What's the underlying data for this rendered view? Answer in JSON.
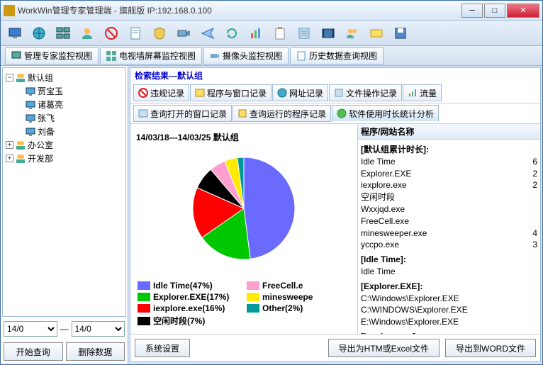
{
  "window": {
    "title": "WorkWin管理专家管理端 - 旗舰版 IP:192.168.0.100"
  },
  "maintabs": [
    {
      "label": "管理专家监控视图"
    },
    {
      "label": "电视墙屏幕监控视图"
    },
    {
      "label": "摄像头监控视图"
    },
    {
      "label": "历史数据查询视图"
    }
  ],
  "tree": {
    "root": {
      "label": "默认组"
    },
    "children": [
      "贾宝玉",
      "诸葛亮",
      "张飞",
      "刘备"
    ],
    "siblings": [
      "办公室",
      "开发部"
    ]
  },
  "date": {
    "from": "14/0",
    "to": "14/0"
  },
  "leftbuttons": {
    "query": "开始查询",
    "delete": "删除数据"
  },
  "search_result": "检索结果---默认组",
  "subtabs_row1": [
    {
      "label": "违规记录"
    },
    {
      "label": "程序与窗口记录"
    },
    {
      "label": "网址记录"
    },
    {
      "label": "文件操作记录"
    },
    {
      "label": "流量"
    }
  ],
  "subtabs_row2": [
    {
      "label": "查询打开的窗口记录"
    },
    {
      "label": "查询运行的程序记录"
    },
    {
      "label": "软件使用时长统计分析"
    }
  ],
  "chart_title": "14/03/18---14/03/25  默认组",
  "chart_data": {
    "type": "pie",
    "title": "14/03/18---14/03/25 默认组",
    "series": [
      {
        "name": "Idle Time",
        "value": 47,
        "color": "#6a6aff"
      },
      {
        "name": "Explorer.EXE",
        "value": 17,
        "color": "#00c800"
      },
      {
        "name": "iexplore.exe",
        "value": 16,
        "color": "#ff0000"
      },
      {
        "name": "空闲时段",
        "value": 7,
        "color": "#000000"
      },
      {
        "name": "FreeCell.exe",
        "value": 5,
        "color": "#ff9ecf"
      },
      {
        "name": "minesweeper",
        "value": 4,
        "color": "#ffea00"
      },
      {
        "name": "Other",
        "value": 2,
        "color": "#009a9a"
      }
    ],
    "legend_labels": [
      "Idle Time(47%)",
      "FreeCell.e",
      "Explorer.EXE(17%)",
      "minesweepe",
      "iexplore.exe(16%)",
      "Other(2%)",
      "空闲时段(7%)",
      ""
    ]
  },
  "list": {
    "header": "程序/网站名称",
    "groups": [
      {
        "title": "[默认组累计时长]:",
        "items": [
          {
            "name": "Idle Time",
            "val": "6"
          },
          {
            "name": "Explorer.EXE",
            "val": "2"
          },
          {
            "name": "iexplore.exe",
            "val": "2"
          },
          {
            "name": "空闲时段",
            "val": ""
          },
          {
            "name": "Wxxjqd.exe",
            "val": ""
          },
          {
            "name": "FreeCell.exe",
            "val": ""
          },
          {
            "name": "minesweeper.exe",
            "val": "4"
          },
          {
            "name": "yccpo.exe",
            "val": "3"
          }
        ]
      },
      {
        "title": "[Idle Time]:",
        "items": [
          {
            "name": "Idle Time",
            "val": ""
          }
        ]
      },
      {
        "title": "[Explorer.EXE]:",
        "items": [
          {
            "name": "C:\\Windows\\Explorer.EXE",
            "val": ""
          },
          {
            "name": "C:\\WINDOWS\\Explorer.EXE",
            "val": ""
          },
          {
            "name": "E:\\Windows\\Explorer.EXE",
            "val": ""
          }
        ]
      },
      {
        "title": "[iexplore.exe]:",
        "items": []
      }
    ]
  },
  "footer": {
    "sys": "系统设置",
    "export_html": "导出为HTM或Excel文件",
    "export_word": "导出到WORD文件"
  }
}
